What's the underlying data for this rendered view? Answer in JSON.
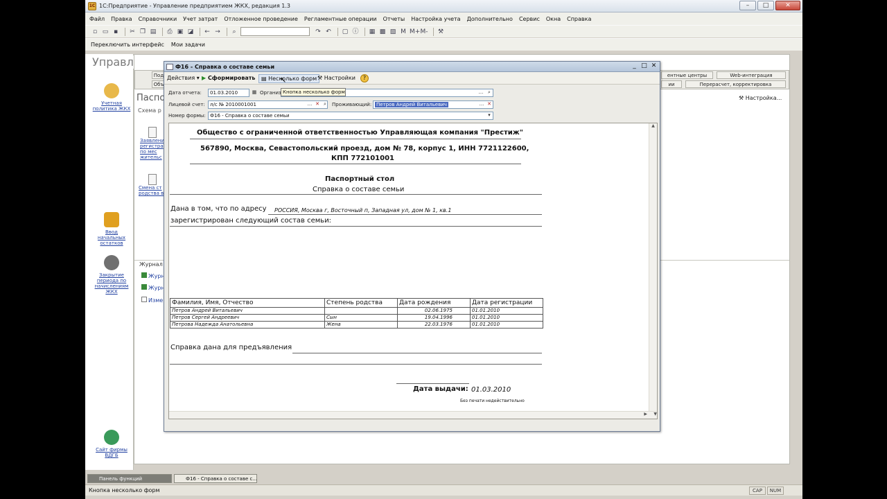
{
  "app": {
    "title": "1С:Предприятие - Управление предприятием ЖКХ, редакция 1.3",
    "icon_text": "1С"
  },
  "menu": [
    "Файл",
    "Правка",
    "Справочники",
    "Учет затрат",
    "Отложенное проведение",
    "Регламентные операции",
    "Отчеты",
    "Настройка учета",
    "Дополнительно",
    "Сервис",
    "Окна",
    "Справка"
  ],
  "toolbar2": {
    "switch_label": "Переключить интерфейс",
    "tasks_label": "Мои задачи"
  },
  "section_title": "Управление ЖКХ",
  "left_panel": [
    {
      "label": "Учетная политика ЖКХ",
      "icon": "policy-icon",
      "color": "#e8b84a"
    },
    {
      "label": "Ввод начальных остатков",
      "icon": "balances-icon",
      "color": "#e0a020"
    },
    {
      "label": "Закрытие периода по начислениям ЖКХ",
      "icon": "gear-icon",
      "color": "#707070"
    },
    {
      "label": "Сайт фирмы ВДГБ",
      "icon": "web-icon",
      "color": "#3a9a5a"
    }
  ],
  "main": {
    "tabs_row1": [
      {
        "label": "Под"
      },
      {
        "label": "ентные центры"
      },
      {
        "label": "Web-интеграция"
      }
    ],
    "tabs_row2": [
      {
        "label": "Объ"
      },
      {
        "label": "ии"
      },
      {
        "label": "Перерасчет, корректировка"
      }
    ],
    "heading": "Паспо",
    "schema_label": "Схема р",
    "settings_label": "Настройка...",
    "items": [
      {
        "label": "Заявлени регистра по мес жительс"
      },
      {
        "label": "Смена ст родства вл"
      }
    ],
    "journal_title": "Журнал",
    "journal_items": [
      {
        "label": "Журн"
      },
      {
        "label": "Журн"
      },
      {
        "label": "Изме"
      }
    ]
  },
  "report_window": {
    "title": "Ф16 - Справка о составе семьи",
    "toolbar": {
      "actions": "Действия",
      "generate": "Сформировать",
      "multi_form": "Несколько форм",
      "settings": "Настройки"
    },
    "tooltip": "Кнопка несколько форм",
    "fields": {
      "date_label": "Дата отчета:",
      "date_value": "01.03.2010",
      "org_label": "Организ",
      "account_label": "Лицевой счет:",
      "account_value": "л/с № 2010001001",
      "resident_label": "Проживающий:",
      "resident_value": "Петров Андрей Витальевич",
      "form_label": "Номер формы:",
      "form_value": "Ф16 - Справка о составе семьи"
    },
    "doc": {
      "org_name": "Общество с ограниченной ответственностью Управляющая компания \"Престиж\"",
      "address_line1": "567890, Москва, Севастопольский проезд, дом № 78, корпус 1, ИНН 7721122600,",
      "address_line2": "КПП 772101001",
      "department": "Паспортный стол",
      "doc_title": "Справка о составе семьи",
      "given_text": "Дана в том, что по адресу",
      "address": "РОССИЯ, Москва г, Восточный п, Западная ул, дом № 1, кв.1",
      "registered_text": "зарегистрирован следующий состав семьи:",
      "columns": [
        "Фамилия, Имя, Отчество",
        "Степень родства",
        "Дата рождения",
        "Дата регистрации"
      ],
      "rows": [
        [
          "Петров Андрей Витальевич",
          "",
          "02.06.1975",
          "01.01.2010"
        ],
        [
          "Петров Сергей Андреевич",
          "Сын",
          "19.04.1996",
          "01.01.2010"
        ],
        [
          "Петрова Надежда Анатольевна",
          "Жена",
          "22.03.1976",
          "01.01.2010"
        ]
      ],
      "presentation_text": "Справка дана для предъявления",
      "issue_label": "Дата выдачи:",
      "issue_date": "01.03.2010",
      "no_stamp": "Без печати недействительно"
    }
  },
  "taskbar": {
    "tab1": "Панель функций",
    "tab2": "Ф16 - Справка о составе с..."
  },
  "statusbar": {
    "text": "Кнопка несколько форм",
    "cap": "CAP",
    "num": "NUM"
  }
}
